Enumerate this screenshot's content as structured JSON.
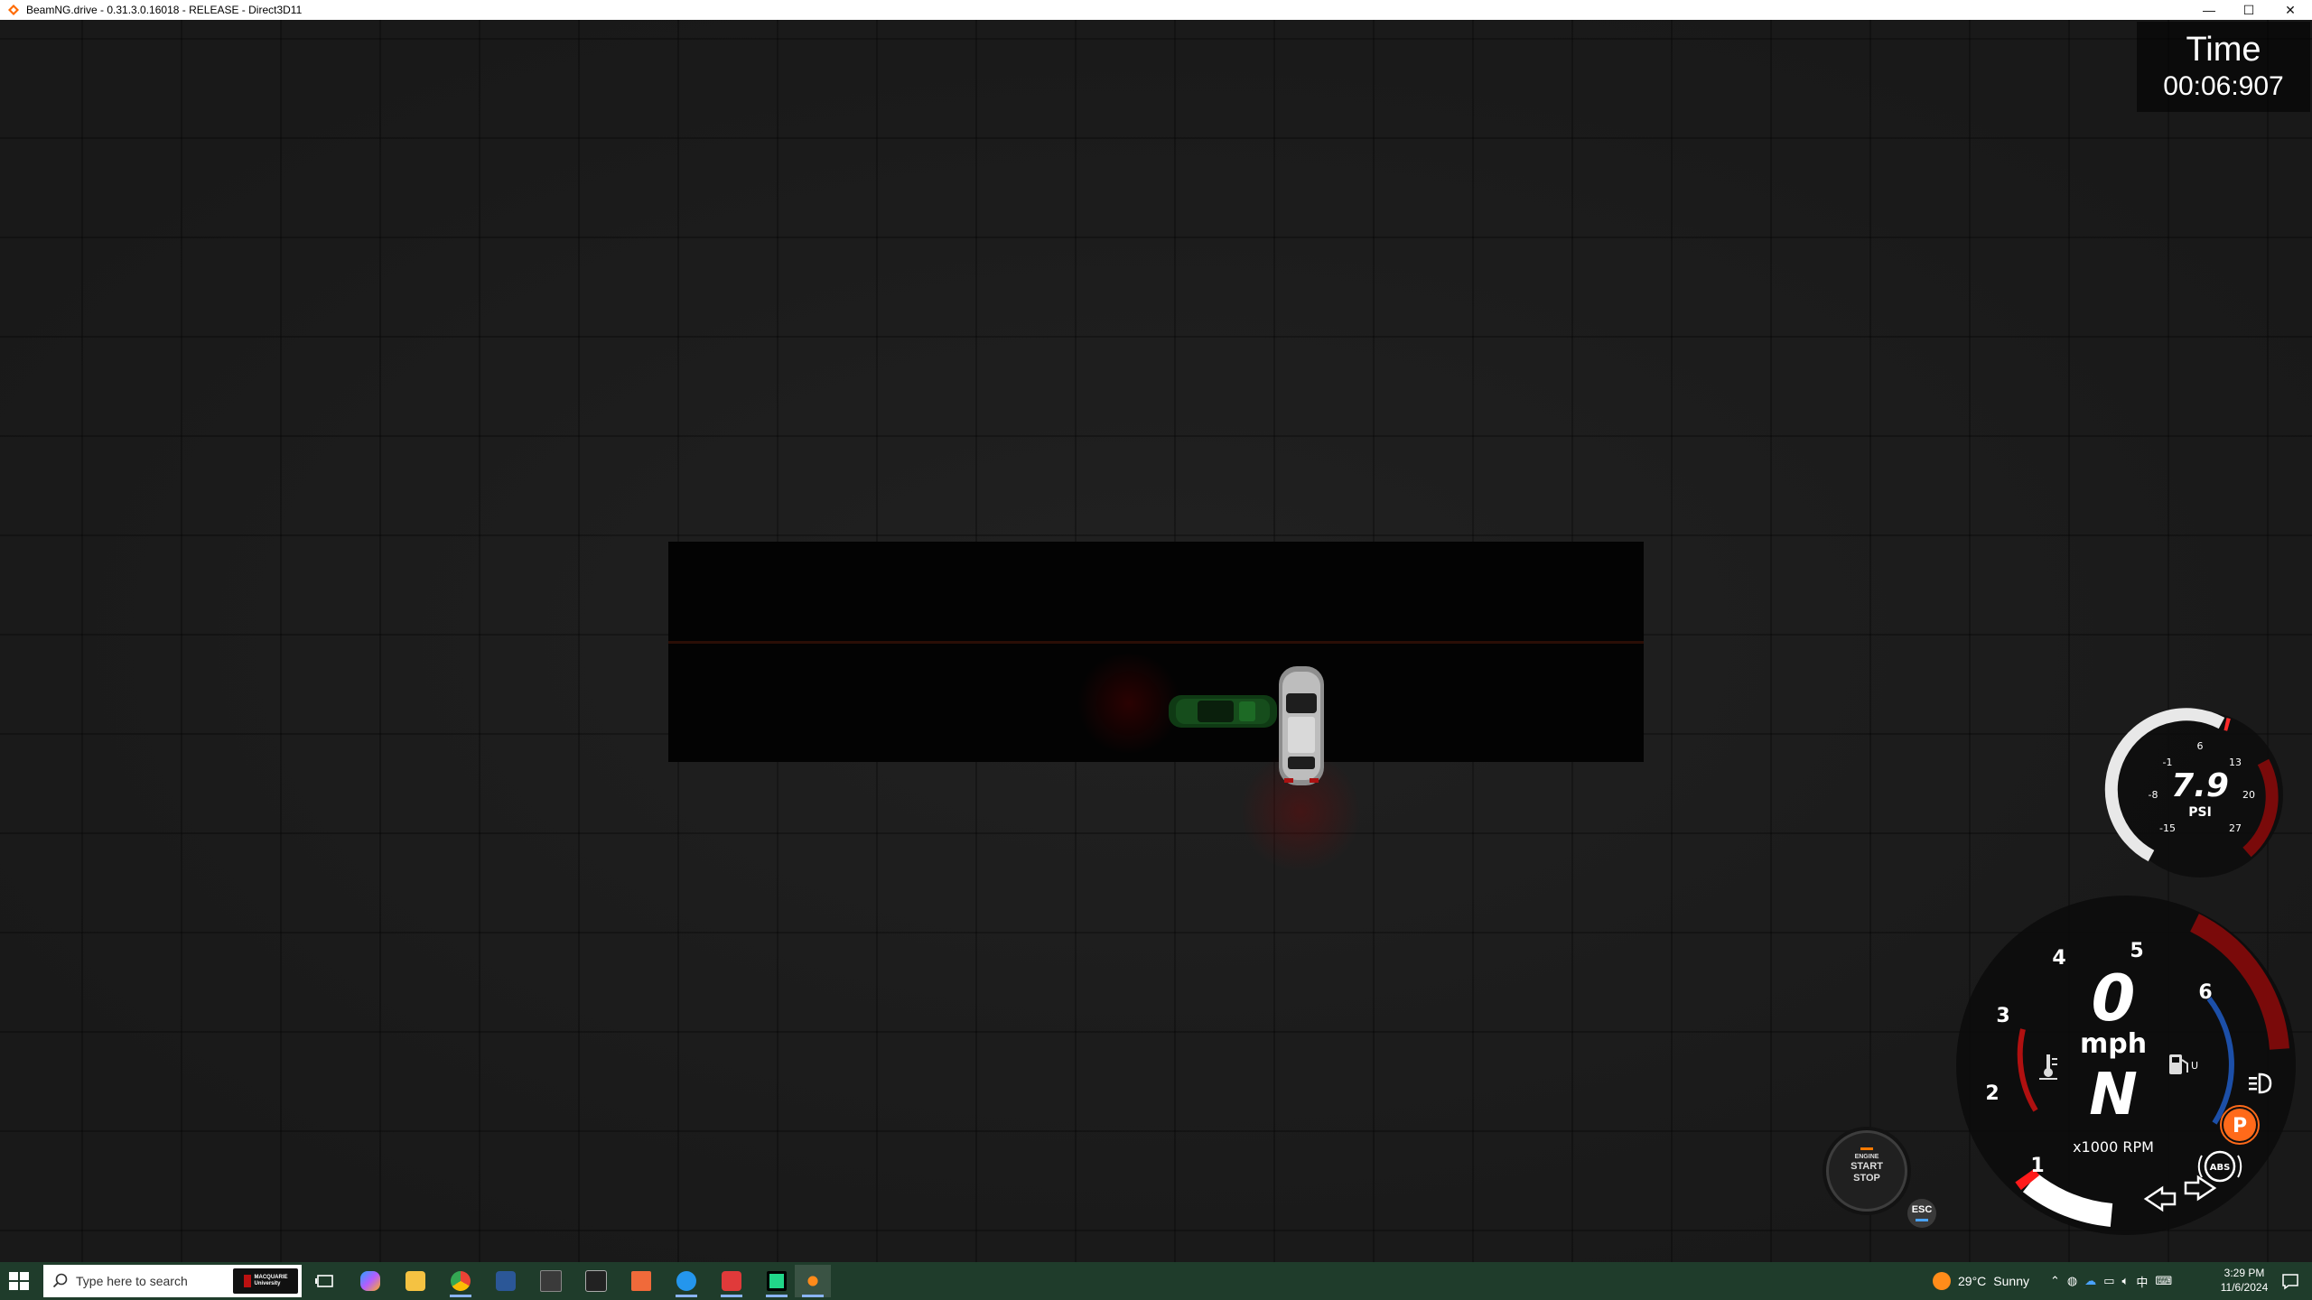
{
  "window": {
    "title": "BeamNG.drive - 0.31.3.0.16018 - RELEASE - Direct3D11",
    "minimize_glyph": "—",
    "maximize_glyph": "☐",
    "close_glyph": "✕"
  },
  "timer": {
    "label": "Time",
    "value": "00:06:907"
  },
  "boost_gauge": {
    "value": "7.9",
    "unit": "PSI",
    "ticks": [
      "-15",
      "-8",
      "-1",
      "6",
      "13",
      "20",
      "27"
    ]
  },
  "main_gauge": {
    "speed": "0",
    "speed_unit": "mph",
    "gear": "N",
    "rpm_unit": "x1000 RPM",
    "rpm_ticks": [
      "1",
      "2",
      "3",
      "4",
      "5",
      "6"
    ],
    "parking_brake": "P",
    "abs": "ABS",
    "fuel_level": "U"
  },
  "engine_button": {
    "line1": "ENGINE",
    "line2": "START",
    "line3": "STOP"
  },
  "esc_button": "ESC",
  "taskbar": {
    "search_placeholder": "Type here to search",
    "brand_line1": "MACQUARIE",
    "brand_line2": "University",
    "weather_temp": "29°C",
    "weather_text": "Sunny",
    "time": "3:29 PM",
    "date": "11/6/2024",
    "ime": "中"
  },
  "colors": {
    "accent_red": "#8b1010",
    "rpm_blue": "#1c4fa8",
    "parking_orange": "#ff6a1a",
    "taskbar_bg": "#1f3c2b"
  }
}
